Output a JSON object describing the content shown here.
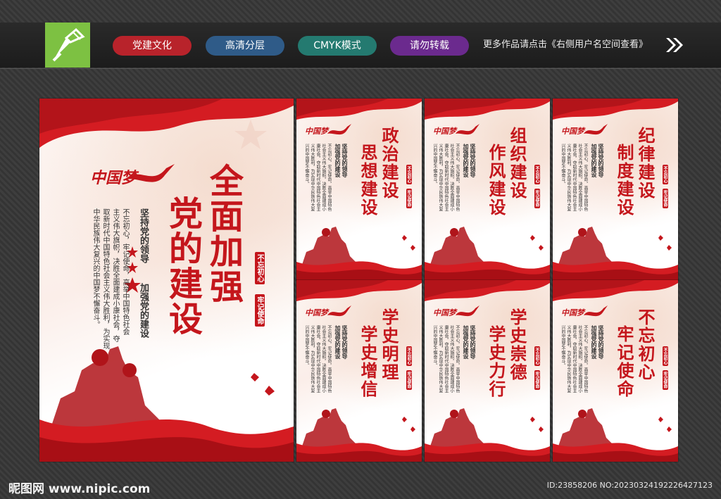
{
  "header": {
    "tags": [
      {
        "label": "党建文化",
        "color": "#b8232b"
      },
      {
        "label": "高清分层",
        "color": "#2f5b88"
      },
      {
        "label": "CMYK模式",
        "color": "#247a70"
      },
      {
        "label": "请勿转载",
        "color": "#6b2a8e"
      }
    ],
    "more_text": "更多作品请点击《右侧用户名空间查看》"
  },
  "main_poster": {
    "brand": "中国梦",
    "title_line1": "全面加强",
    "title_line2": "党的建设",
    "subtitle_line1": "坚持党的领导",
    "subtitle_line2": "加强党的建设",
    "body_lines": [
      "不忘初心，牢记使命，高举中国特色社会",
      "主义伟大旗帜，决胜全面建成小康社会，夺",
      "取新时代中国特色社会主义伟大胜利，为实现",
      "中华民族伟大复兴的中国梦不懈奋斗。"
    ],
    "stamp1": "不忘初心",
    "stamp2": "牢记使命"
  },
  "small_posters": [
    {
      "title_line1": "政治建设",
      "title_line2": "思想建设"
    },
    {
      "title_line1": "组织建设",
      "title_line2": "作风建设"
    },
    {
      "title_line1": "纪律建设",
      "title_line2": "制度建设"
    },
    {
      "title_line1": "学史明理",
      "title_line2": "学史增信"
    },
    {
      "title_line1": "学史崇德",
      "title_line2": "学史力行"
    },
    {
      "title_line1": "不忘初心",
      "title_line2": "牢记使命"
    }
  ],
  "small_common": {
    "brand": "中国梦",
    "sub1": "坚持党的领导",
    "sub2": "加强党的建设",
    "body": "不忘初心，牢记使命，高举中国特色社会主义伟大旗帜，决胜全面建成小康社会，夺取新时代中国特色社会主义伟大胜利，为实现中华民族伟大复兴的中国梦不懈奋斗。",
    "stamp1": "不忘初心",
    "stamp2": "牢记使命"
  },
  "footer": {
    "site": "昵图网 www.nipic.com",
    "id": "ID:23858206 NO:20230324192226427123"
  },
  "colors": {
    "party_red": "#c4161c"
  }
}
